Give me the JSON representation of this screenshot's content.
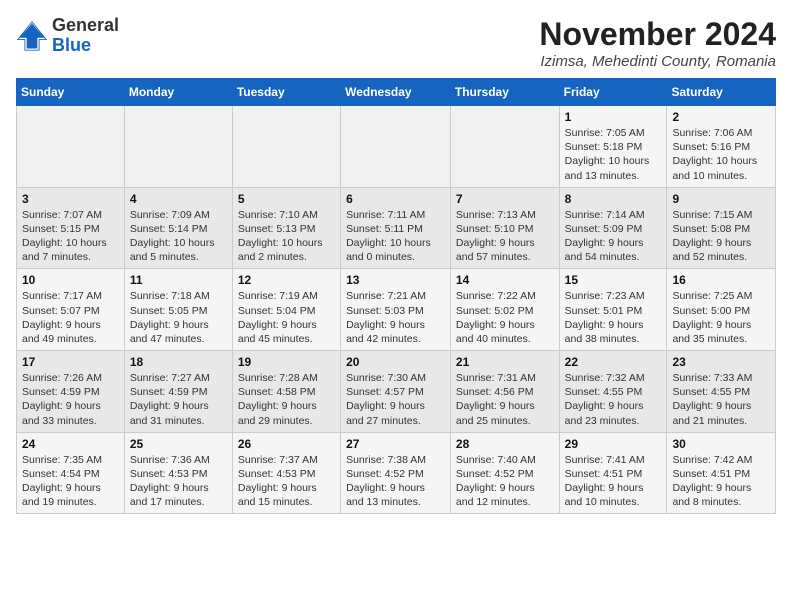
{
  "logo": {
    "line1": "General",
    "line2": "Blue"
  },
  "title": "November 2024",
  "location": "Izimsa, Mehedinti County, Romania",
  "weekdays": [
    "Sunday",
    "Monday",
    "Tuesday",
    "Wednesday",
    "Thursday",
    "Friday",
    "Saturday"
  ],
  "weeks": [
    [
      {
        "day": "",
        "info": ""
      },
      {
        "day": "",
        "info": ""
      },
      {
        "day": "",
        "info": ""
      },
      {
        "day": "",
        "info": ""
      },
      {
        "day": "",
        "info": ""
      },
      {
        "day": "1",
        "info": "Sunrise: 7:05 AM\nSunset: 5:18 PM\nDaylight: 10 hours\nand 13 minutes."
      },
      {
        "day": "2",
        "info": "Sunrise: 7:06 AM\nSunset: 5:16 PM\nDaylight: 10 hours\nand 10 minutes."
      }
    ],
    [
      {
        "day": "3",
        "info": "Sunrise: 7:07 AM\nSunset: 5:15 PM\nDaylight: 10 hours\nand 7 minutes."
      },
      {
        "day": "4",
        "info": "Sunrise: 7:09 AM\nSunset: 5:14 PM\nDaylight: 10 hours\nand 5 minutes."
      },
      {
        "day": "5",
        "info": "Sunrise: 7:10 AM\nSunset: 5:13 PM\nDaylight: 10 hours\nand 2 minutes."
      },
      {
        "day": "6",
        "info": "Sunrise: 7:11 AM\nSunset: 5:11 PM\nDaylight: 10 hours\nand 0 minutes."
      },
      {
        "day": "7",
        "info": "Sunrise: 7:13 AM\nSunset: 5:10 PM\nDaylight: 9 hours\nand 57 minutes."
      },
      {
        "day": "8",
        "info": "Sunrise: 7:14 AM\nSunset: 5:09 PM\nDaylight: 9 hours\nand 54 minutes."
      },
      {
        "day": "9",
        "info": "Sunrise: 7:15 AM\nSunset: 5:08 PM\nDaylight: 9 hours\nand 52 minutes."
      }
    ],
    [
      {
        "day": "10",
        "info": "Sunrise: 7:17 AM\nSunset: 5:07 PM\nDaylight: 9 hours\nand 49 minutes."
      },
      {
        "day": "11",
        "info": "Sunrise: 7:18 AM\nSunset: 5:05 PM\nDaylight: 9 hours\nand 47 minutes."
      },
      {
        "day": "12",
        "info": "Sunrise: 7:19 AM\nSunset: 5:04 PM\nDaylight: 9 hours\nand 45 minutes."
      },
      {
        "day": "13",
        "info": "Sunrise: 7:21 AM\nSunset: 5:03 PM\nDaylight: 9 hours\nand 42 minutes."
      },
      {
        "day": "14",
        "info": "Sunrise: 7:22 AM\nSunset: 5:02 PM\nDaylight: 9 hours\nand 40 minutes."
      },
      {
        "day": "15",
        "info": "Sunrise: 7:23 AM\nSunset: 5:01 PM\nDaylight: 9 hours\nand 38 minutes."
      },
      {
        "day": "16",
        "info": "Sunrise: 7:25 AM\nSunset: 5:00 PM\nDaylight: 9 hours\nand 35 minutes."
      }
    ],
    [
      {
        "day": "17",
        "info": "Sunrise: 7:26 AM\nSunset: 4:59 PM\nDaylight: 9 hours\nand 33 minutes."
      },
      {
        "day": "18",
        "info": "Sunrise: 7:27 AM\nSunset: 4:59 PM\nDaylight: 9 hours\nand 31 minutes."
      },
      {
        "day": "19",
        "info": "Sunrise: 7:28 AM\nSunset: 4:58 PM\nDaylight: 9 hours\nand 29 minutes."
      },
      {
        "day": "20",
        "info": "Sunrise: 7:30 AM\nSunset: 4:57 PM\nDaylight: 9 hours\nand 27 minutes."
      },
      {
        "day": "21",
        "info": "Sunrise: 7:31 AM\nSunset: 4:56 PM\nDaylight: 9 hours\nand 25 minutes."
      },
      {
        "day": "22",
        "info": "Sunrise: 7:32 AM\nSunset: 4:55 PM\nDaylight: 9 hours\nand 23 minutes."
      },
      {
        "day": "23",
        "info": "Sunrise: 7:33 AM\nSunset: 4:55 PM\nDaylight: 9 hours\nand 21 minutes."
      }
    ],
    [
      {
        "day": "24",
        "info": "Sunrise: 7:35 AM\nSunset: 4:54 PM\nDaylight: 9 hours\nand 19 minutes."
      },
      {
        "day": "25",
        "info": "Sunrise: 7:36 AM\nSunset: 4:53 PM\nDaylight: 9 hours\nand 17 minutes."
      },
      {
        "day": "26",
        "info": "Sunrise: 7:37 AM\nSunset: 4:53 PM\nDaylight: 9 hours\nand 15 minutes."
      },
      {
        "day": "27",
        "info": "Sunrise: 7:38 AM\nSunset: 4:52 PM\nDaylight: 9 hours\nand 13 minutes."
      },
      {
        "day": "28",
        "info": "Sunrise: 7:40 AM\nSunset: 4:52 PM\nDaylight: 9 hours\nand 12 minutes."
      },
      {
        "day": "29",
        "info": "Sunrise: 7:41 AM\nSunset: 4:51 PM\nDaylight: 9 hours\nand 10 minutes."
      },
      {
        "day": "30",
        "info": "Sunrise: 7:42 AM\nSunset: 4:51 PM\nDaylight: 9 hours\nand 8 minutes."
      }
    ]
  ]
}
